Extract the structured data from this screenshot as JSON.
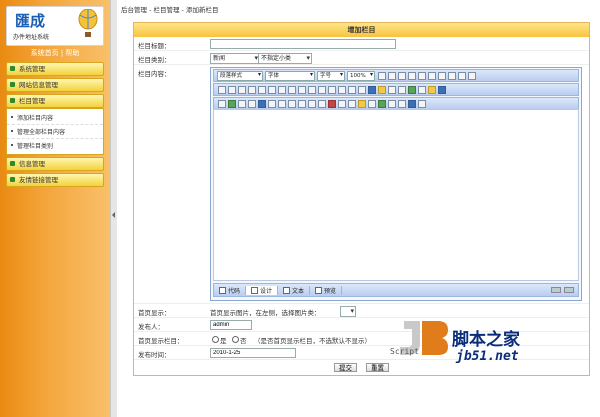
{
  "sidebar": {
    "logo_title": "匯成",
    "logo_subtitle": "办件地址系统",
    "links": [
      "系统首页",
      "帮助"
    ],
    "items": [
      {
        "label": "系统管理"
      },
      {
        "label": "网站信息管理"
      },
      {
        "label": "栏目管理",
        "sub": [
          "添加栏目内容",
          "管理全部栏目内容",
          "管理栏目类别"
        ]
      },
      {
        "label": "信息管理"
      },
      {
        "label": "友情链接管理"
      }
    ]
  },
  "breadcrumb": "后台管理 - 栏目管理 - 添加新栏目",
  "form": {
    "title": "增加栏目",
    "fields": {
      "title_label": "栏目标题：",
      "type_label": "栏目类别：",
      "type_value": "新闻",
      "subtype_value": "不指定小类",
      "content_label": "栏目内容：",
      "home_label": "首页显示：",
      "home_text": "首页显示图片，在左侧，选择图片类：",
      "publisher_label": "发布人：",
      "publisher_value": "admin",
      "show_label": "首页显示栏目：",
      "radio_yes": "是",
      "radio_no": "否",
      "show_hint": "（是否首页显示栏目，不选默认不显示）",
      "time_label": "发布时间：",
      "time_value": "2010-1-25"
    },
    "editor": {
      "para_select": "段落样式",
      "font_select": "字体",
      "size_select": "字号",
      "zoom_select": "100%",
      "tabs": [
        "代码",
        "设计",
        "文本",
        "预览"
      ]
    },
    "buttons": {
      "submit": "提交",
      "reset": "重置"
    }
  },
  "watermark": {
    "brand": "脚本之家",
    "url": "jb51.net",
    "script": "Script"
  }
}
